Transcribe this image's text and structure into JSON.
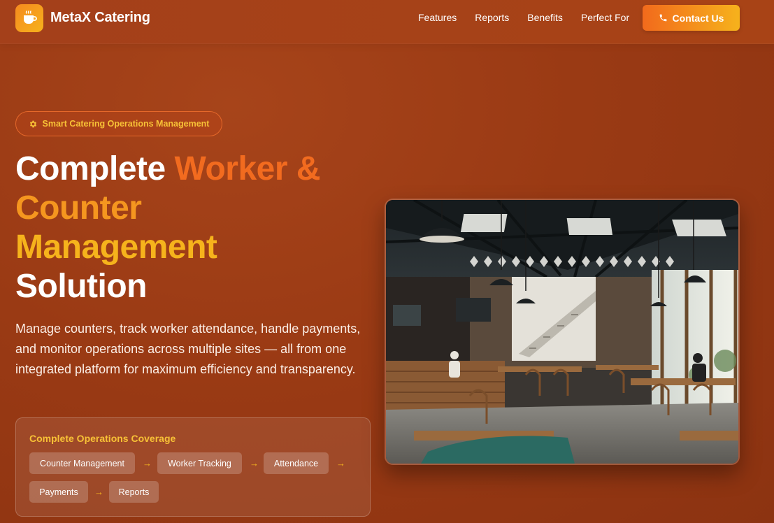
{
  "nav": {
    "brand": "MetaX Catering",
    "links": [
      "Features",
      "Reports",
      "Benefits",
      "Perfect For"
    ],
    "contact_label": "Contact Us"
  },
  "hero": {
    "badge": "Smart Catering Operations Management",
    "headline": {
      "line1_white": "Complete ",
      "line1_accent": "Worker &",
      "line2": "Counter",
      "line3": "Management",
      "line4": "Solution"
    },
    "description": "Manage counters, track worker attendance, handle payments, and monitor operations across multiple sites — all from one integrated platform for maximum efficiency and transparency."
  },
  "coverage": {
    "title": "Complete Operations Coverage",
    "items": [
      "Counter Management",
      "Worker Tracking",
      "Attendance",
      "Payments",
      "Reports"
    ],
    "arrow": "→"
  },
  "icons": {
    "logo": "coffee-cup-icon",
    "contact": "phone-icon",
    "badge": "gear-icon"
  },
  "colors": {
    "background": "#9a3a14",
    "accent_orange": "#f26b1f",
    "accent_amber": "#f5961f",
    "accent_yellow": "#f6b31c",
    "badge_text": "#f7c136"
  }
}
